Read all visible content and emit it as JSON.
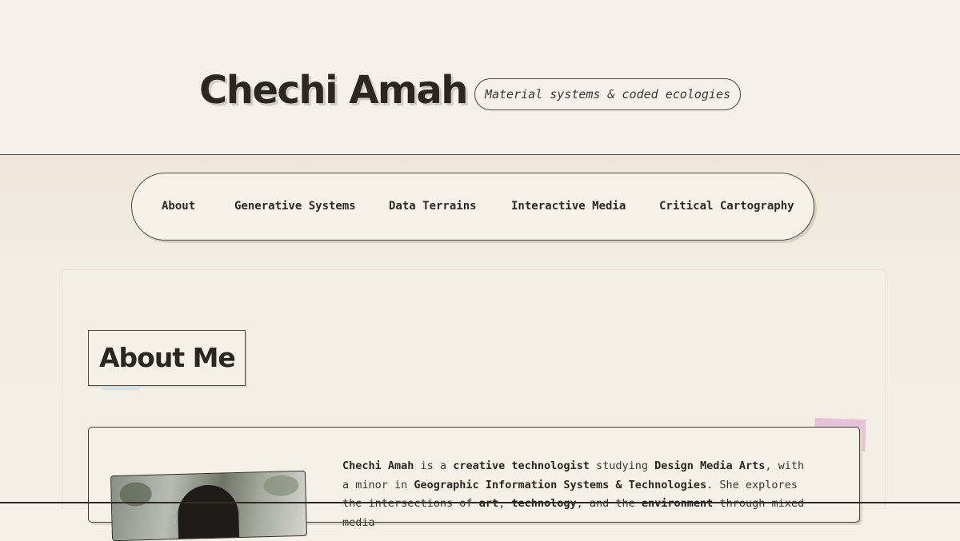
{
  "header": {
    "site_title": "Chechi Amah",
    "tagline": "Material systems & coded ecologies"
  },
  "nav": {
    "items": [
      {
        "label": "About"
      },
      {
        "label": "Generative Systems"
      },
      {
        "label": "Data Terrains"
      },
      {
        "label": "Interactive Media"
      },
      {
        "label": "Critical Cartography"
      }
    ]
  },
  "about": {
    "section_title": "About Me",
    "bio": {
      "name": "Chechi Amah",
      "t1": " is a ",
      "role": "creative technologist",
      "t2": " studying ",
      "major": "Design Media Arts",
      "t3": ", with a minor in ",
      "minor": "Geographic Information Systems & Technologies",
      "t4": ". She explores the intersections of ",
      "kw1": "art",
      "t5": ", ",
      "kw2": "technology",
      "t6": ", and the ",
      "kw3": "environment",
      "t7": " through mixed media"
    }
  },
  "colors": {
    "background": "#f5f1e9",
    "ink": "#2a2723",
    "accent_pink": "#e6c3d8",
    "accent_blue": "#cfe2ea"
  }
}
